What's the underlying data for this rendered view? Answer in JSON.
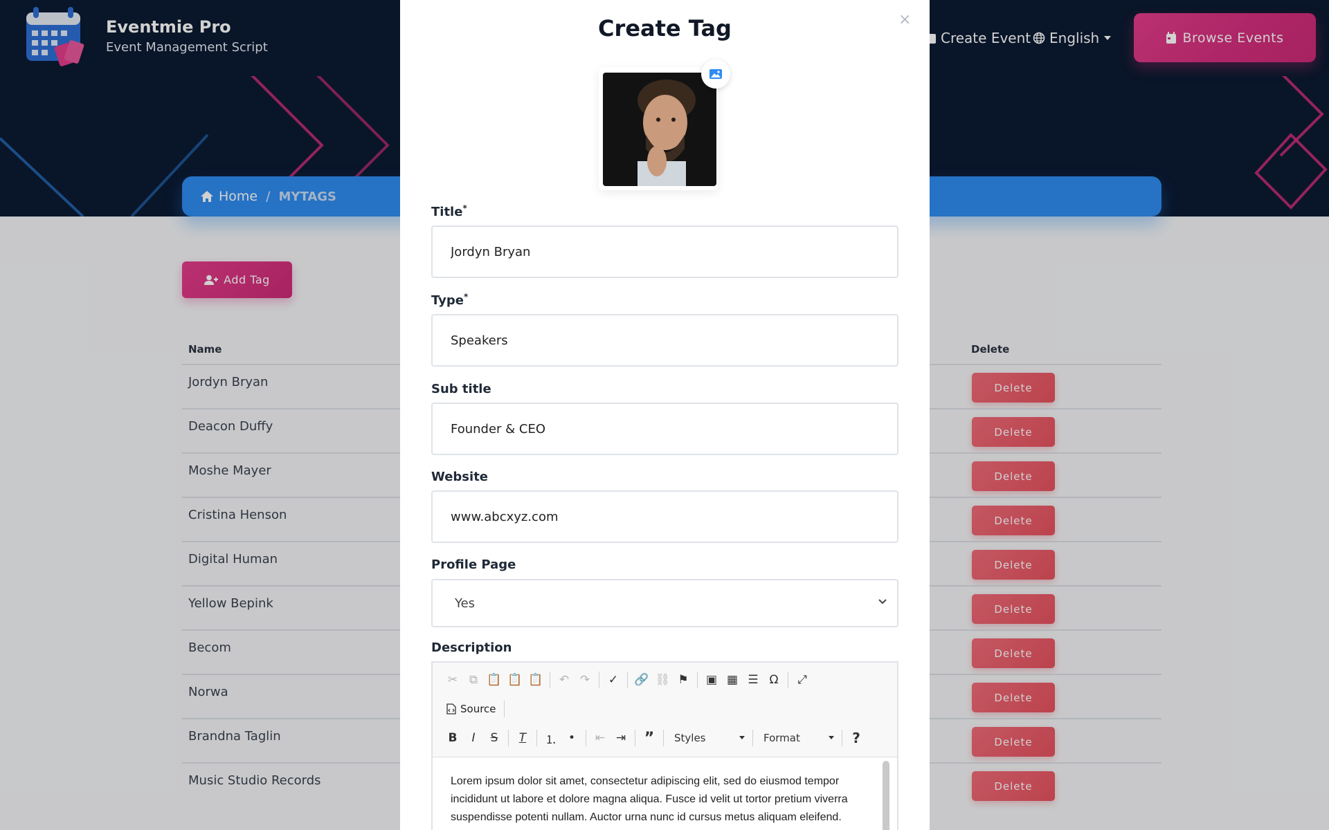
{
  "header": {
    "brand_name": "Eventmie Pro",
    "brand_sub": "Event Management Script",
    "nav_create": "Create Event",
    "nav_lang": "English",
    "browse_btn": "Browse Events"
  },
  "breadcrumb": {
    "home": "Home",
    "sep": "/",
    "current": "MYTAGS"
  },
  "page": {
    "add_tag": "Add Tag",
    "col_name": "Name",
    "col_delete": "Delete",
    "rows": [
      {
        "name": "Jordyn Bryan",
        "action": "Delete"
      },
      {
        "name": "Deacon Duffy",
        "action": "Delete"
      },
      {
        "name": "Moshe Mayer",
        "action": "Delete"
      },
      {
        "name": "Cristina Henson",
        "action": "Delete"
      },
      {
        "name": "Digital Human",
        "action": "Delete"
      },
      {
        "name": "Yellow Bepink",
        "action": "Delete"
      },
      {
        "name": "Becom",
        "action": "Delete"
      },
      {
        "name": "Norwa",
        "action": "Delete"
      },
      {
        "name": "Brandna Taglin",
        "action": "Delete"
      },
      {
        "name": "Music Studio Records",
        "action": "Delete"
      }
    ]
  },
  "modal": {
    "title": "Create Tag",
    "close": "×",
    "title_label": "Title",
    "title_value": "Jordyn Bryan",
    "type_label": "Type",
    "type_value": "Speakers",
    "subtitle_label": "Sub title",
    "subtitle_value": "Founder & CEO",
    "website_label": "Website",
    "website_value": "www.abcxyz.com",
    "profile_label": "Profile Page",
    "profile_value": "Yes",
    "required_mark": "*",
    "description_label": "Description",
    "editor": {
      "source_label": "Source",
      "styles_label": "Styles",
      "format_label": "Format",
      "help": "?",
      "body": "Lorem ipsum dolor sit amet, consectetur adipiscing elit, sed do eiusmod tempor incididunt ut labore et dolore magna aliqua. Fusce id velit ut tortor pretium viverra suspendisse potenti nullam. Auctor urna nunc id cursus metus aliquam eleifend."
    }
  },
  "colors": {
    "header_bg": "#0c1a31",
    "brand_pink": "#d52f7e",
    "breadcrumb_blue": "#2f8cf0",
    "delete_red": "#e5525f"
  },
  "icons": [
    "calendar-logo-icon",
    "calendar-plus-icon",
    "globe-icon",
    "caret-down-icon",
    "calendar-icon",
    "home-icon",
    "user-plus-icon",
    "image-icon",
    "close-icon",
    "chevron-down-icon"
  ]
}
